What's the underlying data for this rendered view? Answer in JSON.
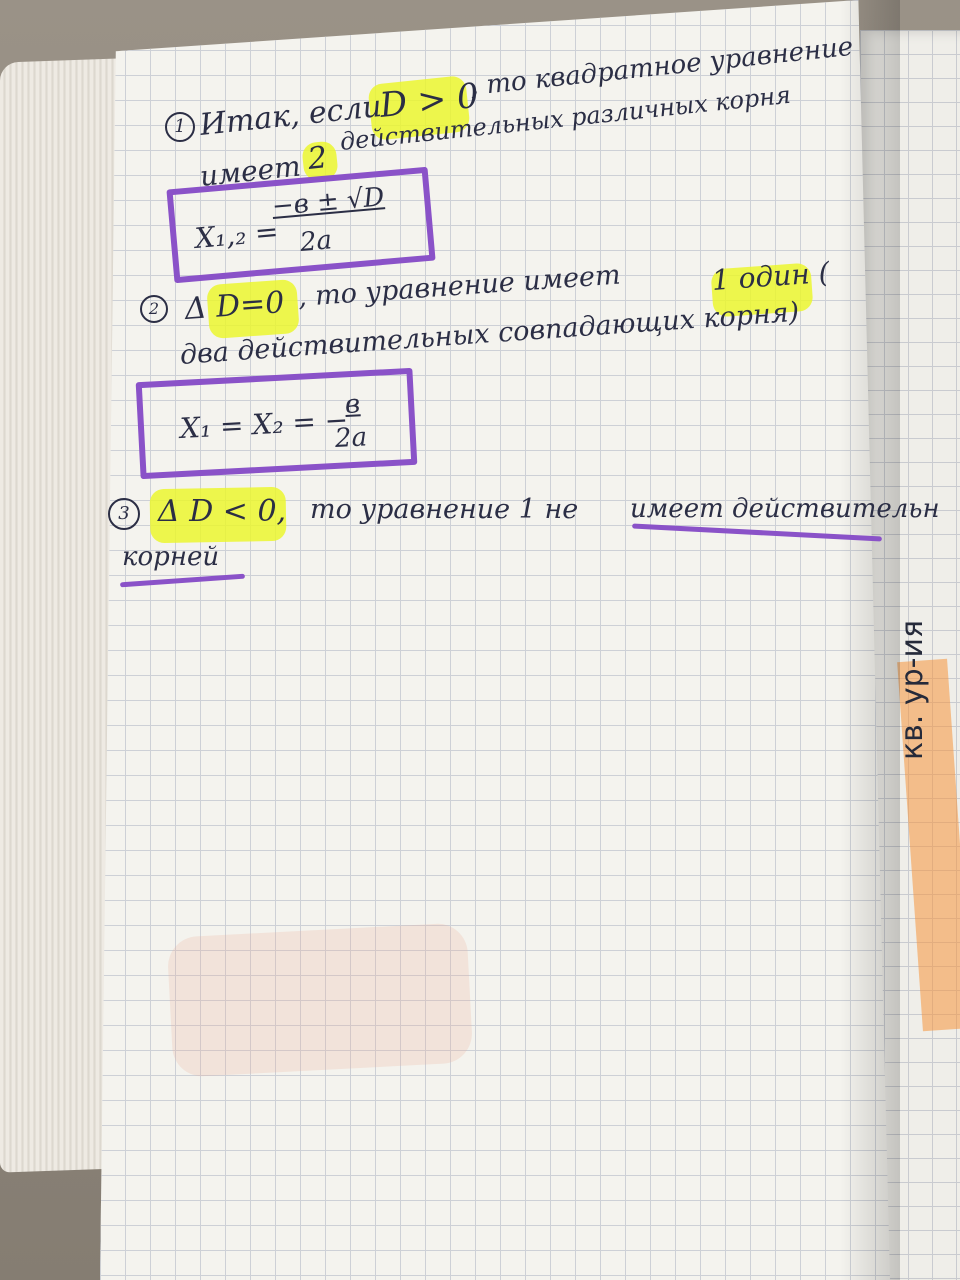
{
  "notes": {
    "item1": {
      "number": "1",
      "line1": "Итак, если",
      "condition": "D > 0",
      "line1_rest": ", то квадратное уравнение",
      "line2_start": "имеет",
      "count": "2",
      "line2_rest": "действительных различных корня",
      "formula_lhs": "X₁,₂ =",
      "formula_num": "−в ± √D",
      "formula_den": "2a"
    },
    "item2": {
      "number": "2",
      "condition": "Δ D=0",
      "line1_rest": ", то уравнение имеет",
      "count": "1 один (",
      "line2": "два действительных совпадающих корня)",
      "formula_lhs": "X₁ = X₂ = −",
      "formula_num": "в",
      "formula_den": "2a"
    },
    "item3": {
      "number": "3",
      "condition": "Δ D < 0,",
      "line1_rest": "то уравнение 1 не",
      "emphasis": "имеет действительн",
      "line2": "корней"
    }
  },
  "adjacent_page": {
    "text": "кв. ур-ия"
  },
  "colors": {
    "ink": "#2b2e45",
    "highlighter_yellow": "#ecf628",
    "marker_purple": "#8a52c8",
    "highlighter_orange": "#f5963c"
  }
}
